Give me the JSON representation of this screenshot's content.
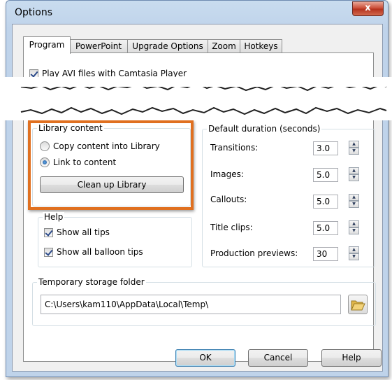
{
  "window": {
    "title": "Options",
    "close_glyph": "x"
  },
  "tabs": [
    {
      "label": "Program",
      "active": true
    },
    {
      "label": "PowerPoint",
      "active": false
    },
    {
      "label": "Upgrade Options",
      "active": false
    },
    {
      "label": "Zoom",
      "active": false
    },
    {
      "label": "Hotkeys",
      "active": false
    }
  ],
  "program": {
    "play_avi": {
      "label": "Play AVI files with Camtasia Player",
      "checked": true
    },
    "library_content": {
      "title": "Library content",
      "options": [
        {
          "label": "Copy content into Library",
          "selected": false
        },
        {
          "label": "Link to content",
          "selected": true
        }
      ],
      "cleanup_label": "Clean up Library"
    },
    "help": {
      "title": "Help",
      "show_all_tips": {
        "label": "Show all tips",
        "checked": true
      },
      "show_all_balloon_tips": {
        "label": "Show all balloon tips",
        "checked": true
      }
    },
    "default_duration": {
      "title": "Default duration (seconds)",
      "rows": [
        {
          "label": "Transitions:",
          "value": "3.0"
        },
        {
          "label": "Images:",
          "value": "5.0"
        },
        {
          "label": "Callouts:",
          "value": "5.0"
        },
        {
          "label": "Title clips:",
          "value": "5.0"
        },
        {
          "label": "Production previews:",
          "value": "30"
        }
      ]
    },
    "temp_storage": {
      "title": "Temporary storage folder",
      "path": "C:\\Users\\kam110\\AppData\\Local\\Temp\\"
    }
  },
  "footer": {
    "ok_label": "OK",
    "cancel_label": "Cancel",
    "help_label": "Help"
  },
  "colors": {
    "highlight": "#e07020",
    "title_bar": "#bfd3ea",
    "close_button": "#c8452f"
  },
  "icons": {
    "folder": "folder-open-icon",
    "spin_up": "spin-up-icon",
    "spin_down": "spin-down-icon"
  }
}
